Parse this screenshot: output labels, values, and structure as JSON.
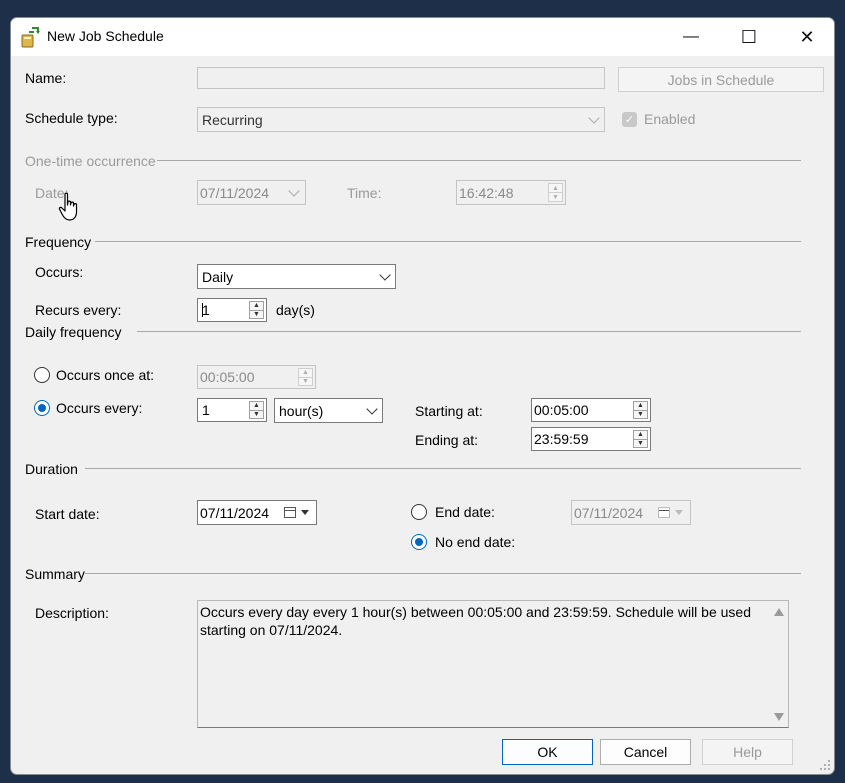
{
  "window": {
    "title": "New Job Schedule",
    "controls": {
      "minimize": "—",
      "maximize": "☐",
      "close": "✕"
    }
  },
  "name": {
    "label": "Name:",
    "value": ""
  },
  "jobs_in_schedule": "Jobs in Schedule",
  "schedule_type": {
    "label": "Schedule type:",
    "value": "Recurring"
  },
  "enabled": {
    "label": "Enabled",
    "checked": true
  },
  "one_time": {
    "header": "One-time occurrence",
    "date_label": "Date:",
    "date_value": "07/11/2024",
    "time_label": "Time:",
    "time_value": "16:42:48"
  },
  "frequency": {
    "header": "Frequency",
    "occurs_label": "Occurs:",
    "occurs_value": "Daily",
    "recurs_label": "Recurs every:",
    "recurs_value": "1",
    "recurs_unit": "day(s)"
  },
  "daily_frequency": {
    "header": "Daily frequency",
    "once_label": "Occurs once at:",
    "once_value": "00:05:00",
    "every_label": "Occurs every:",
    "every_value": "1",
    "every_unit": "hour(s)",
    "starting_label": "Starting at:",
    "starting_value": "00:05:00",
    "ending_label": "Ending at:",
    "ending_value": "23:59:59",
    "selected": "every"
  },
  "duration": {
    "header": "Duration",
    "start_label": "Start date:",
    "start_value": "07/11/2024",
    "end_label": "End date:",
    "end_value": "07/11/2024",
    "no_end_label": "No end date:",
    "selected": "no_end"
  },
  "summary": {
    "header": "Summary",
    "description_label": "Description:",
    "description": "Occurs every day every 1 hour(s) between 00:05:00 and 23:59:59. Schedule will be used starting on 07/11/2024."
  },
  "buttons": {
    "ok": "OK",
    "cancel": "Cancel",
    "help": "Help"
  },
  "colors": {
    "accent": "#0067c0",
    "disabled_text": "#9a9a9a",
    "backdrop": "#1e2f4a"
  }
}
